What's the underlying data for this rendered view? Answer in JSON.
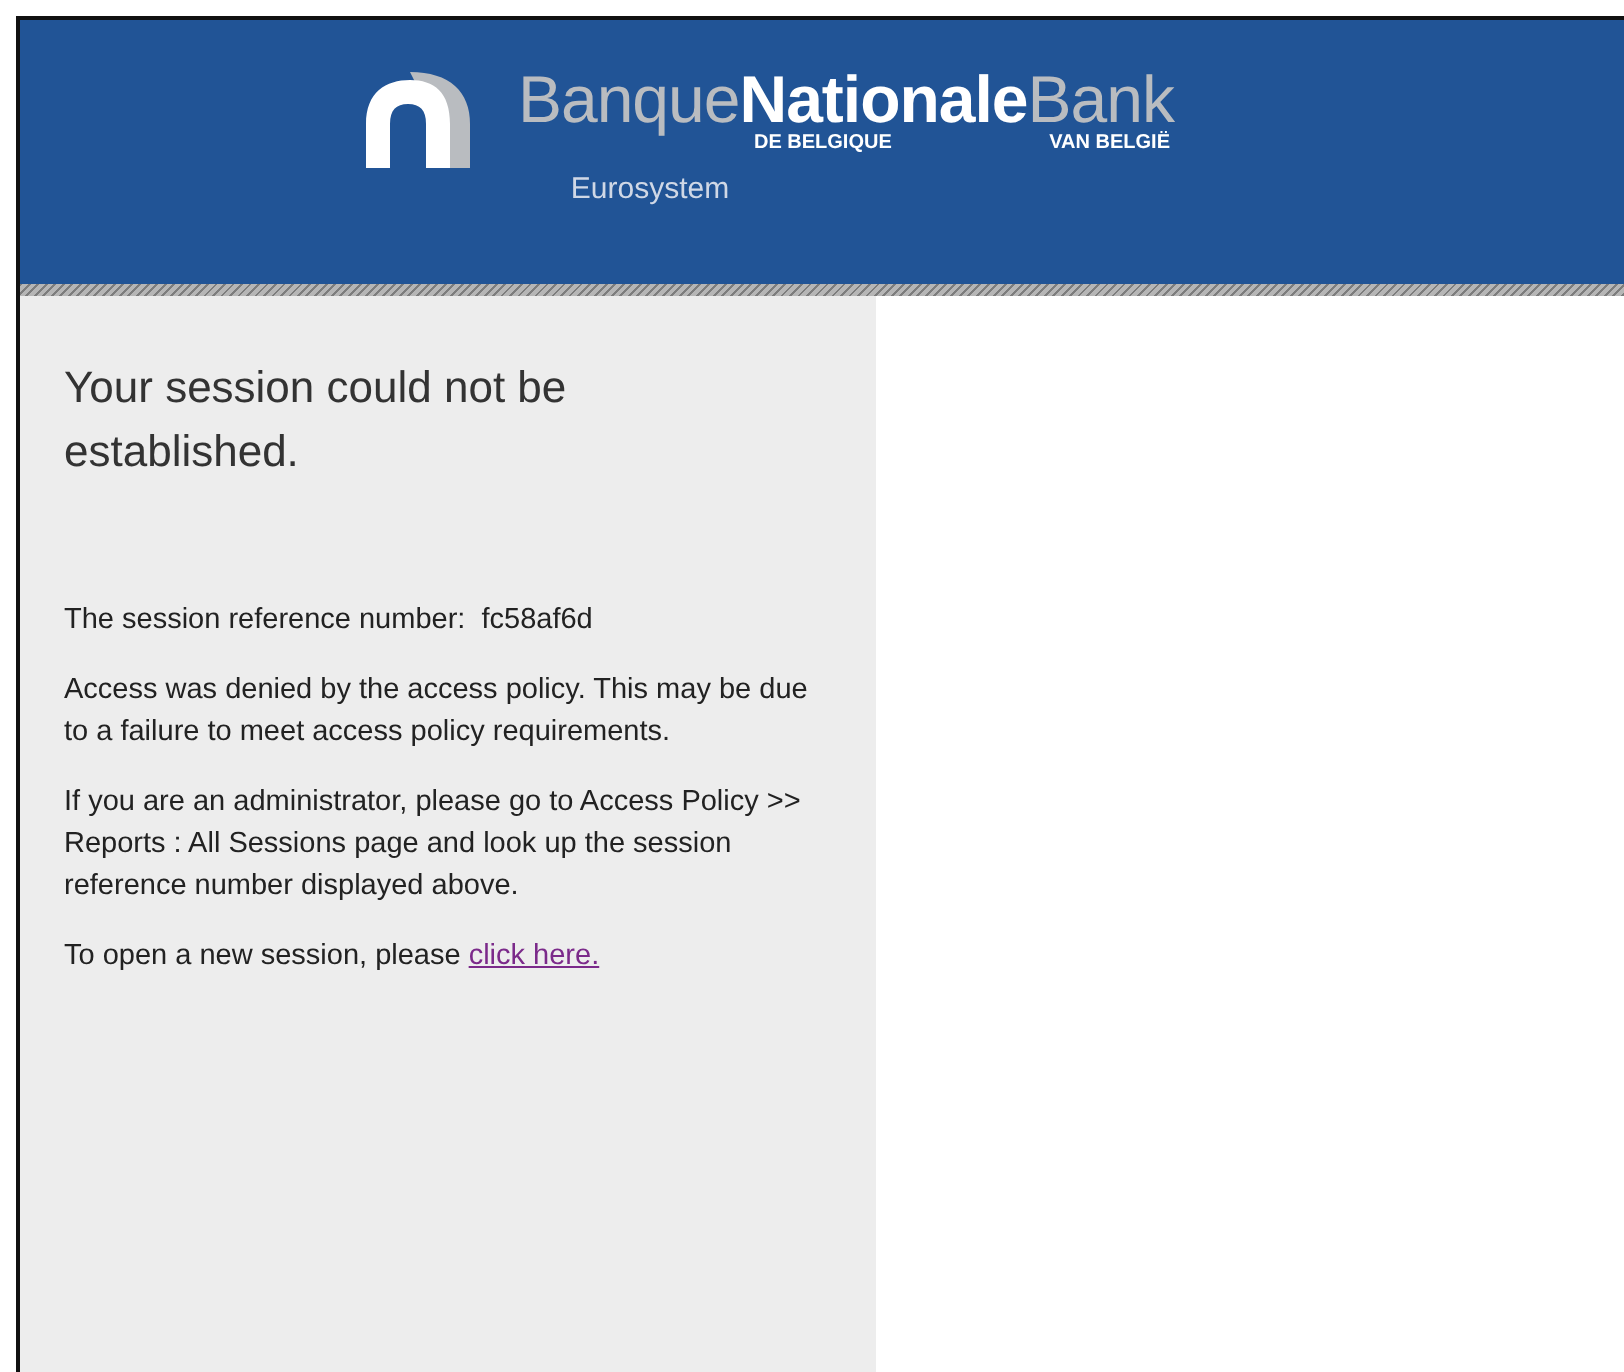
{
  "header": {
    "logo": {
      "word_1": "Banque",
      "word_2": "Nationale",
      "word_3": "Bank",
      "subtitle_1": "DE BELGIQUE",
      "subtitle_2": "VAN BELGIË"
    },
    "tagline": "Eurosystem"
  },
  "panel": {
    "heading": "Your session could not be established.",
    "reference": {
      "label": "The session reference number:",
      "value": "fc58af6d"
    },
    "paragraphs": [
      "Access was denied by the access policy. This may be due to a failure to meet access policy requirements.",
      "If you are an administrator, please go to Access Policy >> Reports : All Sessions page and look up the session reference number displayed above."
    ],
    "new_session": {
      "text": "To open a new session, please",
      "link": "click here."
    }
  }
}
